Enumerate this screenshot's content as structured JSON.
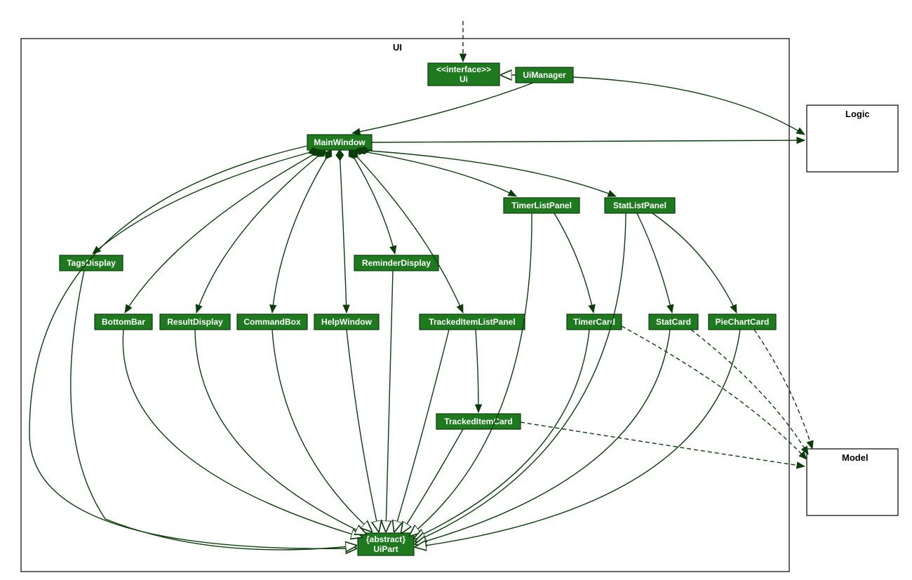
{
  "diagram": {
    "packages": {
      "ui": "UI",
      "logic": "Logic",
      "model": "Model"
    },
    "classes": {
      "uiInterface": {
        "stereotype": "<<interface>>",
        "name": "Ui"
      },
      "uiManager": "UiManager",
      "mainWindow": "MainWindow",
      "tagsDisplay": "TagsDisplay",
      "bottomBar": "BottomBar",
      "resultDisplay": "ResultDisplay",
      "commandBox": "CommandBox",
      "helpWindow": "HelpWindow",
      "reminderDisplay": "ReminderDisplay",
      "trackedItemListPanel": "TrackedItemListPanel",
      "timerListPanel": "TimerListPanel",
      "statListPanel": "StatListPanel",
      "timerCard": "TimerCard",
      "statCard": "StatCard",
      "pieChartCard": "PieChartCard",
      "trackedItemCard": "TrackedItemCard",
      "uiPart": {
        "stereotype": "{abstract}",
        "name": "UiPart"
      }
    },
    "relationships": [
      {
        "from": "external",
        "to": "uiInterface",
        "type": "dependency"
      },
      {
        "from": "uiManager",
        "to": "uiInterface",
        "type": "realization"
      },
      {
        "from": "uiManager",
        "to": "mainWindow",
        "type": "association"
      },
      {
        "from": "uiManager",
        "to": "logic",
        "type": "association"
      },
      {
        "from": "mainWindow",
        "to": "logic",
        "type": "association"
      },
      {
        "from": "mainWindow",
        "to": "tagsDisplay",
        "type": "composition"
      },
      {
        "from": "mainWindow",
        "to": "bottomBar",
        "type": "composition"
      },
      {
        "from": "mainWindow",
        "to": "resultDisplay",
        "type": "composition"
      },
      {
        "from": "mainWindow",
        "to": "commandBox",
        "type": "composition"
      },
      {
        "from": "mainWindow",
        "to": "helpWindow",
        "type": "composition"
      },
      {
        "from": "mainWindow",
        "to": "reminderDisplay",
        "type": "composition"
      },
      {
        "from": "mainWindow",
        "to": "trackedItemListPanel",
        "type": "composition"
      },
      {
        "from": "mainWindow",
        "to": "timerListPanel",
        "type": "composition"
      },
      {
        "from": "mainWindow",
        "to": "statListPanel",
        "type": "composition"
      },
      {
        "from": "timerListPanel",
        "to": "timerCard",
        "type": "association"
      },
      {
        "from": "statListPanel",
        "to": "statCard",
        "type": "association"
      },
      {
        "from": "statListPanel",
        "to": "pieChartCard",
        "type": "association"
      },
      {
        "from": "trackedItemListPanel",
        "to": "trackedItemCard",
        "type": "association"
      },
      {
        "from": "trackedItemCard",
        "to": "model",
        "type": "dependency"
      },
      {
        "from": "timerCard",
        "to": "model",
        "type": "dependency"
      },
      {
        "from": "statCard",
        "to": "model",
        "type": "dependency"
      },
      {
        "from": "pieChartCard",
        "to": "model",
        "type": "dependency"
      },
      {
        "from": "mainWindow",
        "to": "uiPart",
        "type": "generalization"
      },
      {
        "from": "tagsDisplay",
        "to": "uiPart",
        "type": "generalization"
      },
      {
        "from": "bottomBar",
        "to": "uiPart",
        "type": "generalization"
      },
      {
        "from": "resultDisplay",
        "to": "uiPart",
        "type": "generalization"
      },
      {
        "from": "commandBox",
        "to": "uiPart",
        "type": "generalization"
      },
      {
        "from": "helpWindow",
        "to": "uiPart",
        "type": "generalization"
      },
      {
        "from": "reminderDisplay",
        "to": "uiPart",
        "type": "generalization"
      },
      {
        "from": "trackedItemListPanel",
        "to": "uiPart",
        "type": "generalization"
      },
      {
        "from": "timerListPanel",
        "to": "uiPart",
        "type": "generalization"
      },
      {
        "from": "timerCard",
        "to": "uiPart",
        "type": "generalization"
      },
      {
        "from": "statListPanel",
        "to": "uiPart",
        "type": "generalization"
      },
      {
        "from": "statCard",
        "to": "uiPart",
        "type": "generalization"
      },
      {
        "from": "pieChartCard",
        "to": "uiPart",
        "type": "generalization"
      },
      {
        "from": "trackedItemCard",
        "to": "uiPart",
        "type": "generalization"
      }
    ]
  }
}
